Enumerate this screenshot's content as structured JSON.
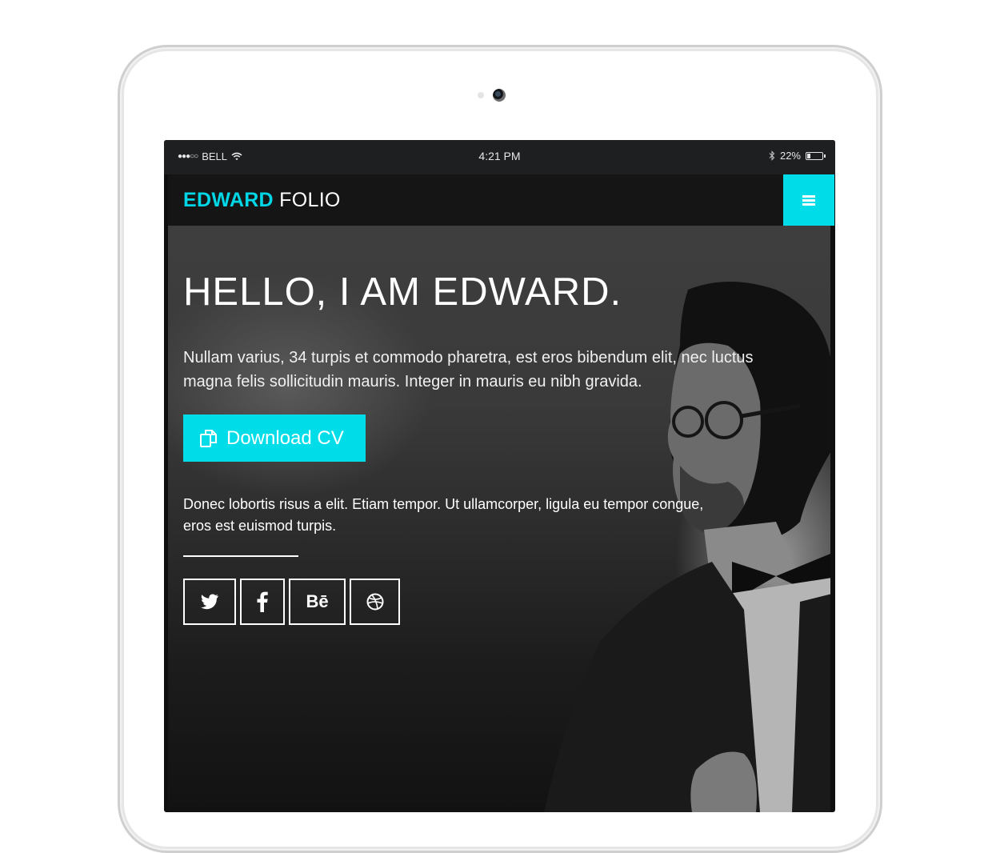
{
  "statusbar": {
    "carrier": "BELL",
    "time": "4:21 PM",
    "battery_label": "22%",
    "battery_level": 0.22
  },
  "navbar": {
    "brand_first": "EDWARD",
    "brand_second": " FOLIO",
    "menu_icon": "hamburger-icon"
  },
  "hero": {
    "heading": "HELLO, I AM EDWARD.",
    "lead": "Nullam varius, 34 turpis et commodo pharetra, est eros bibendum elit, nec luctus magna felis sollicitudin mauris. Integer in mauris eu nibh gravida.",
    "cta_label": "Download CV",
    "cta_icon": "documents-icon",
    "sub": "Donec lobortis risus a elit. Etiam tempor. Ut ullamcorper, ligula eu tempor congue, eros est euismod turpis."
  },
  "socials": [
    {
      "icon": "twitter-icon"
    },
    {
      "icon": "facebook-icon"
    },
    {
      "icon": "behance-icon",
      "text": "Bē"
    },
    {
      "icon": "dribbble-icon"
    }
  ],
  "colors": {
    "accent": "#00dde9",
    "navbar_bg": "#151516",
    "statusbar_bg": "#1e1f21"
  }
}
